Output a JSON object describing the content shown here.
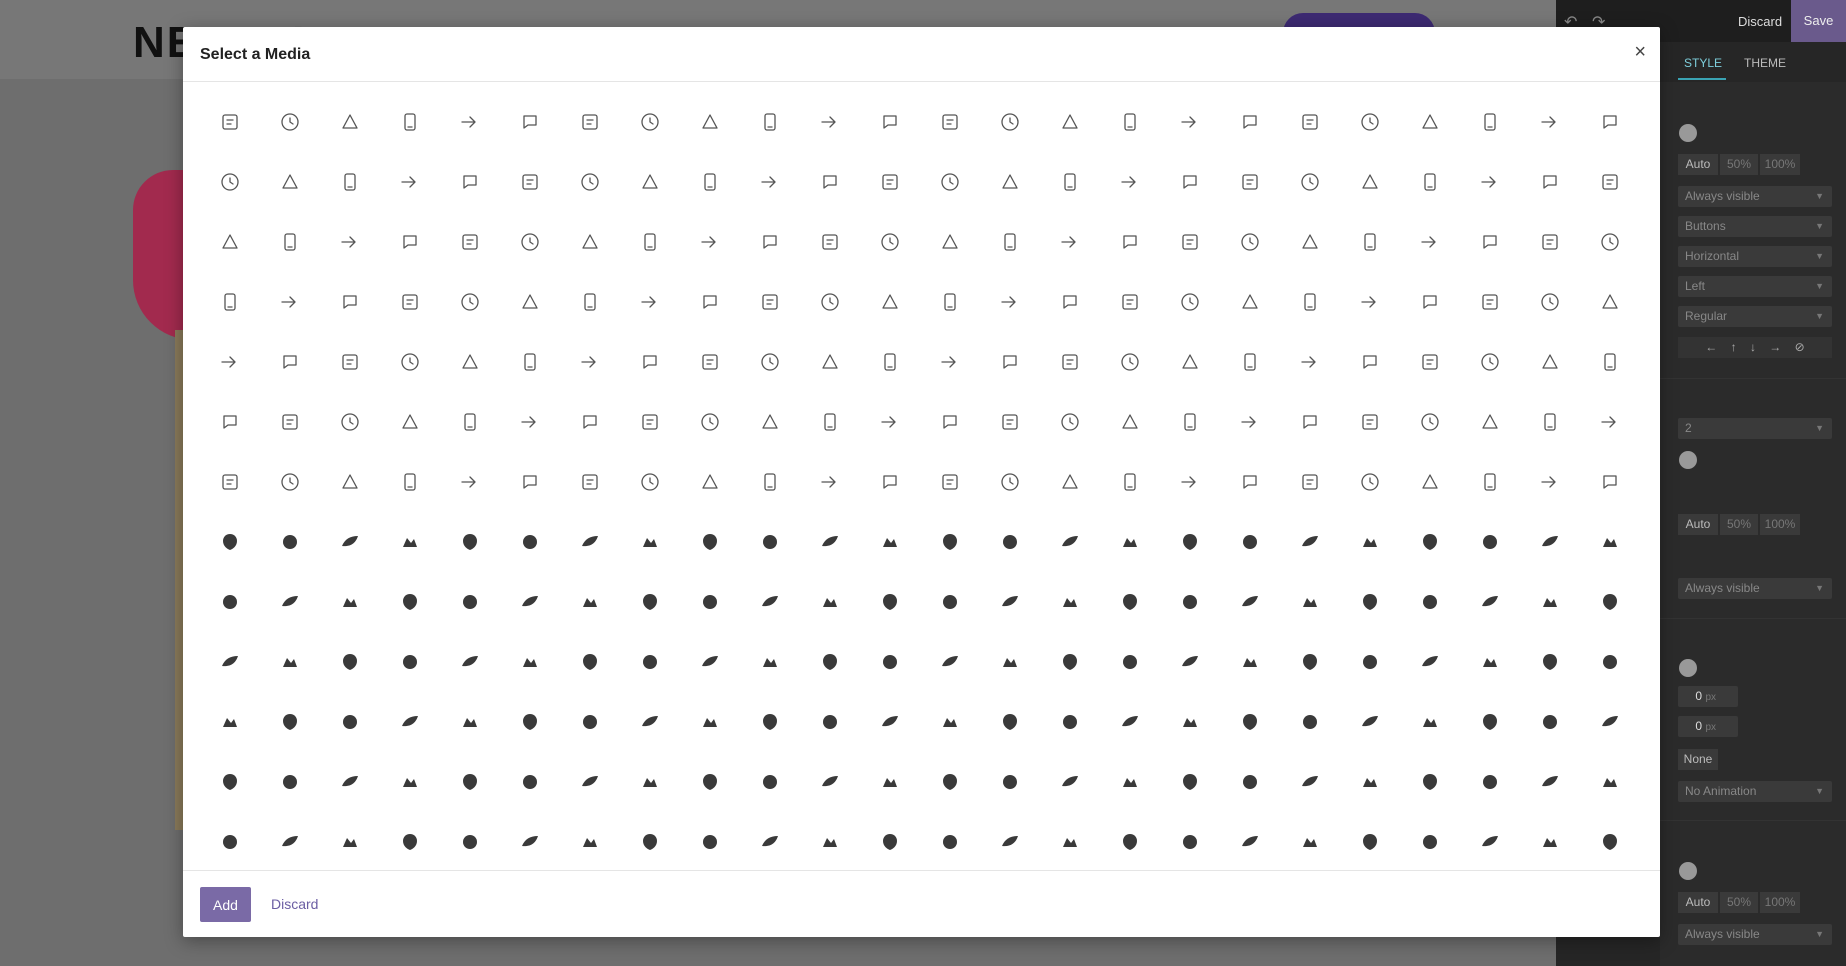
{
  "background": {
    "logo_text": "NEXTBIT"
  },
  "editor": {
    "discard_label": "Discard",
    "save_label": "Save",
    "tabs": [
      "STYLE",
      "THEME"
    ],
    "width_options": [
      "Auto",
      "50%",
      "100%"
    ],
    "visibility": "Always visible",
    "layout_select": "Buttons",
    "direction_select": "Horizontal",
    "align_select": "Left",
    "weight_select": "Regular",
    "columns_select": "2",
    "spacing_values": [
      "0",
      "0"
    ],
    "spacing_unit": "px",
    "border_label": "None",
    "animation_select": "No Animation"
  },
  "modal": {
    "title": "Select a Media",
    "close_label": "×",
    "add_label": "Add",
    "discard_label": "Discard"
  },
  "icons": {
    "outline_rows": [
      [
        "column-icon",
        "battery-icon",
        "vr-headset-icon",
        "apple-icon",
        "hand-pointer-icon",
        "battery-full-icon",
        "basketball-icon",
        "fast-food-icon",
        "trophy-cup-icon",
        "bottle-icon",
        "wallet-icon",
        "umbrella-icon",
        "tv-icon",
        "coffee-cup-icon",
        "screen-icon",
        "mobile-icon",
        "ice-cream-icon",
        "book-icon",
        "wifi-icon",
        "jar-icon",
        "radio-icon",
        "pizza-icon",
        "smartphone-icon",
        "laptop-icon"
      ],
      [
        "beer-icon",
        "id-card-icon",
        "printer-icon",
        "info-icon",
        "eraser-icon",
        "ice-cream-cone-icon",
        "hourglass-icon",
        "question-icon",
        "forward-icon",
        "glasses-icon",
        "fridge-icon",
        "cutlery-icon",
        "share-icon",
        "sign-in-icon",
        "gas-station-icon",
        "drop-icon",
        "download-icon",
        "money-icon",
        "money-bill-icon",
        "monitor-icon",
        "corkscrew-icon",
        "trash-bin-icon",
        "bar-chart-icon",
        "line-chart-icon"
      ],
      [
        "area-chart-icon",
        "calculator-icon",
        "shirt-icon",
        "bottle-small-icon",
        "bottle-tall-icon",
        "money-bag-icon",
        "arrow-right-icon",
        "broadcast-icon",
        "pacifier-icon",
        "anchor-icon",
        "plane-icon",
        "target-icon",
        "link-icon",
        "truck-icon",
        "stopwatch-icon",
        "clock-icon",
        "archive-icon",
        "star-icon",
        "cart-icon",
        "shield-icon",
        "syringe-icon",
        "heartbeat-icon",
        "bandage-icon",
        "paper-plane-icon"
      ],
      [
        "pill-icon",
        "basket-icon",
        "phone-icon",
        "pencil-icon",
        "pen-icon",
        "paperclip-icon",
        "toggle-icon",
        "mouse-icon",
        "megaphone-icon",
        "chain-icon",
        "keyboard-icon",
        "home-icon",
        "heart-icon",
        "headphones-icon",
        "cart-add-icon",
        "expand-icon",
        "folder-icon",
        "file-icon",
        "document-icon",
        "document-text-icon",
        "inbox-full-icon",
        "compress-icon",
        "inbox-icon",
        "trash-icon"
      ],
      [
        "gamepad-icon",
        "timer-icon",
        "compass-drawing-icon",
        "clipboard-icon",
        "clipboard-chart-icon",
        "flask-icon",
        "compass-icon",
        "brush-icon",
        "car-icon",
        "open-book-icon",
        "bus-icon",
        "bicycle-icon",
        "wrench-icon",
        "newspaper-icon",
        "watch-icon",
        "speaker-icon",
        "radio-small-icon",
        "users-icon",
        "user-icon",
        "cloud-icon",
        "chat-dots-icon",
        "tools-icon",
        "tag-icon",
        "dashboard-icon"
      ],
      [
        "share-nodes-icon",
        "gear-icon",
        "search-icon",
        "guitar-icon",
        "contact-card-icon",
        "bell-icon",
        "contact-book-icon",
        "refresh-icon",
        "power-icon",
        "map-pin-icon",
        "image-icon",
        "lock-open-icon",
        "book-open-icon",
        "mute-icon",
        "film-icon",
        "microphone-icon",
        "comment-icon",
        "comments-icon",
        "chat-text-icon",
        "list-alt-icon",
        "play-icon",
        "envelope-icon",
        "list-icon",
        "layers-icon"
      ],
      [
        "key-icon",
        "mail-open-icon",
        "eye-icon",
        "edit-icon",
        "camera-icon",
        "cloud-sync-icon",
        "photo-camera-icon",
        "cloud-outline-icon",
        "padlock-icon",
        "pie-chart-icon",
        "lightbulb-icon",
        "briefcase-icon",
        "news-icon",
        "calendar-icon",
        "cocktail-icon",
        "cauldron-icon",
        "antlers-icon",
        "bow-icon",
        "castle-icon",
        "brain-icon",
        "crown-icon",
        "crown-solid-icon",
        "spiral-icon",
        "cyclist-icon"
      ]
    ],
    "solid_rows": [
      [
        "mask-icon",
        "evil-eye-icon",
        "tulip-icon",
        "horseshoe-icon",
        "snowman-icon",
        "pumpkin-icon",
        "fist-icon",
        "lightning-icon",
        "skull-bones-icon",
        "broken-heart-icon",
        "witch-hat-icon",
        "globe-hands-icon",
        "lips-icon",
        "moon-icon",
        "bug-icon",
        "hourglass-solid-icon",
        "shield-solid-icon",
        "sun-icon",
        "skull-crossbones-icon",
        "skull-icon",
        "iron-icon",
        "rocket-icon",
        "badge-star-icon",
        "triskelion-icon"
      ],
      [
        "feather-icon",
        "church-icon",
        "tree-icon",
        "envelope-solid-icon",
        "clover-icon",
        "cannabis-icon",
        "ornament-icon",
        "bat-icon",
        "bear-icon",
        "footprints-icon",
        "gorilla-icon",
        "seahorse-icon",
        "bird-icon",
        "eagle-icon",
        "birds-icon",
        "bone-icon",
        "bison-icon",
        "butterfly-icon",
        "butterfly-solid-icon",
        "camel-icon",
        "chameleon-icon",
        "camel-two-icon",
        "cat-lying-icon",
        "snail-icon"
      ],
      [
        "cat-icon",
        "shrimp-icon",
        "cat-face-icon",
        "lizard-icon",
        "cow-head-icon",
        "cow-icon",
        "crab-icon",
        "crocodile-icon",
        "deer-head-icon",
        "dog-icon",
        "dragon-icon",
        "fox-sitting-icon",
        "dolphin-icon",
        "dragonfly-icon",
        "duck-icon",
        "dinosaur-icon",
        "bird-flying-icon",
        "elephant-head-icon",
        "brain-solid-icon",
        "elephant-icon",
        "elk-icon",
        "fish-bone-icon",
        "fish-icon",
        "fish-alt-icon"
      ],
      [
        "clownfish-icon",
        "piranha-icon",
        "tropical-fish-icon",
        "fox-head-icon",
        "frog-sitting-icon",
        "lizard-walk-icon",
        "gecko-icon",
        "frog-face-icon",
        "goat-icon",
        "pangolin-icon",
        "giraffe-icon",
        "giraffe-alt-icon",
        "gazelle-icon",
        "gorilla-solid-icon",
        "grass-icon",
        "fly-icon",
        "horse-head-icon",
        "hummingbird-icon",
        "jellyfish-feet-icon",
        "jellyfish-icon",
        "kangaroo-icon",
        "anteater-icon",
        "leaf-bird-icon",
        "lion-icon"
      ],
      [
        "lion-head-icon",
        "lemur-icon",
        "seahorse-alt-icon",
        "monkey-icon",
        "monkey-face-icon",
        "octopus-icon",
        "octopus-alt-icon",
        "squid-icon",
        "owl-icon",
        "panda-icon",
        "panda-sitting-icon",
        "parrot-icon",
        "penguin-face-icon",
        "platypus-icon",
        "paw-icon",
        "turtle-icon",
        "penguin-icon",
        "pig-face-icon",
        "pig-icon",
        "bird-wings-icon",
        "dove-icon",
        "raven-icon",
        "rabbit-icon",
        "mouse-solid-icon"
      ],
      [
        "rhino-icon",
        "rat-icon",
        "rooster-icon",
        "seahorse-solid-icon",
        "shark-fin-icon",
        "shrimp-solid-icon",
        "prawn-icon",
        "snail-solid-icon",
        "slug-icon",
        "spiral-shell-icon",
        "bug-walk-icon",
        "worm-icon",
        "squid-alt-icon",
        "squirrel-icon",
        "tiger-face-icon",
        "tiger-icon",
        "tortoise-icon",
        "swan-icon",
        "hummingbird-solid-icon",
        "unicorn-icon",
        "acer-logo-icon",
        "adidas-logo-icon",
        "adobe-logo-icon",
        "amazon-pay-logo-icon"
      ]
    ]
  }
}
